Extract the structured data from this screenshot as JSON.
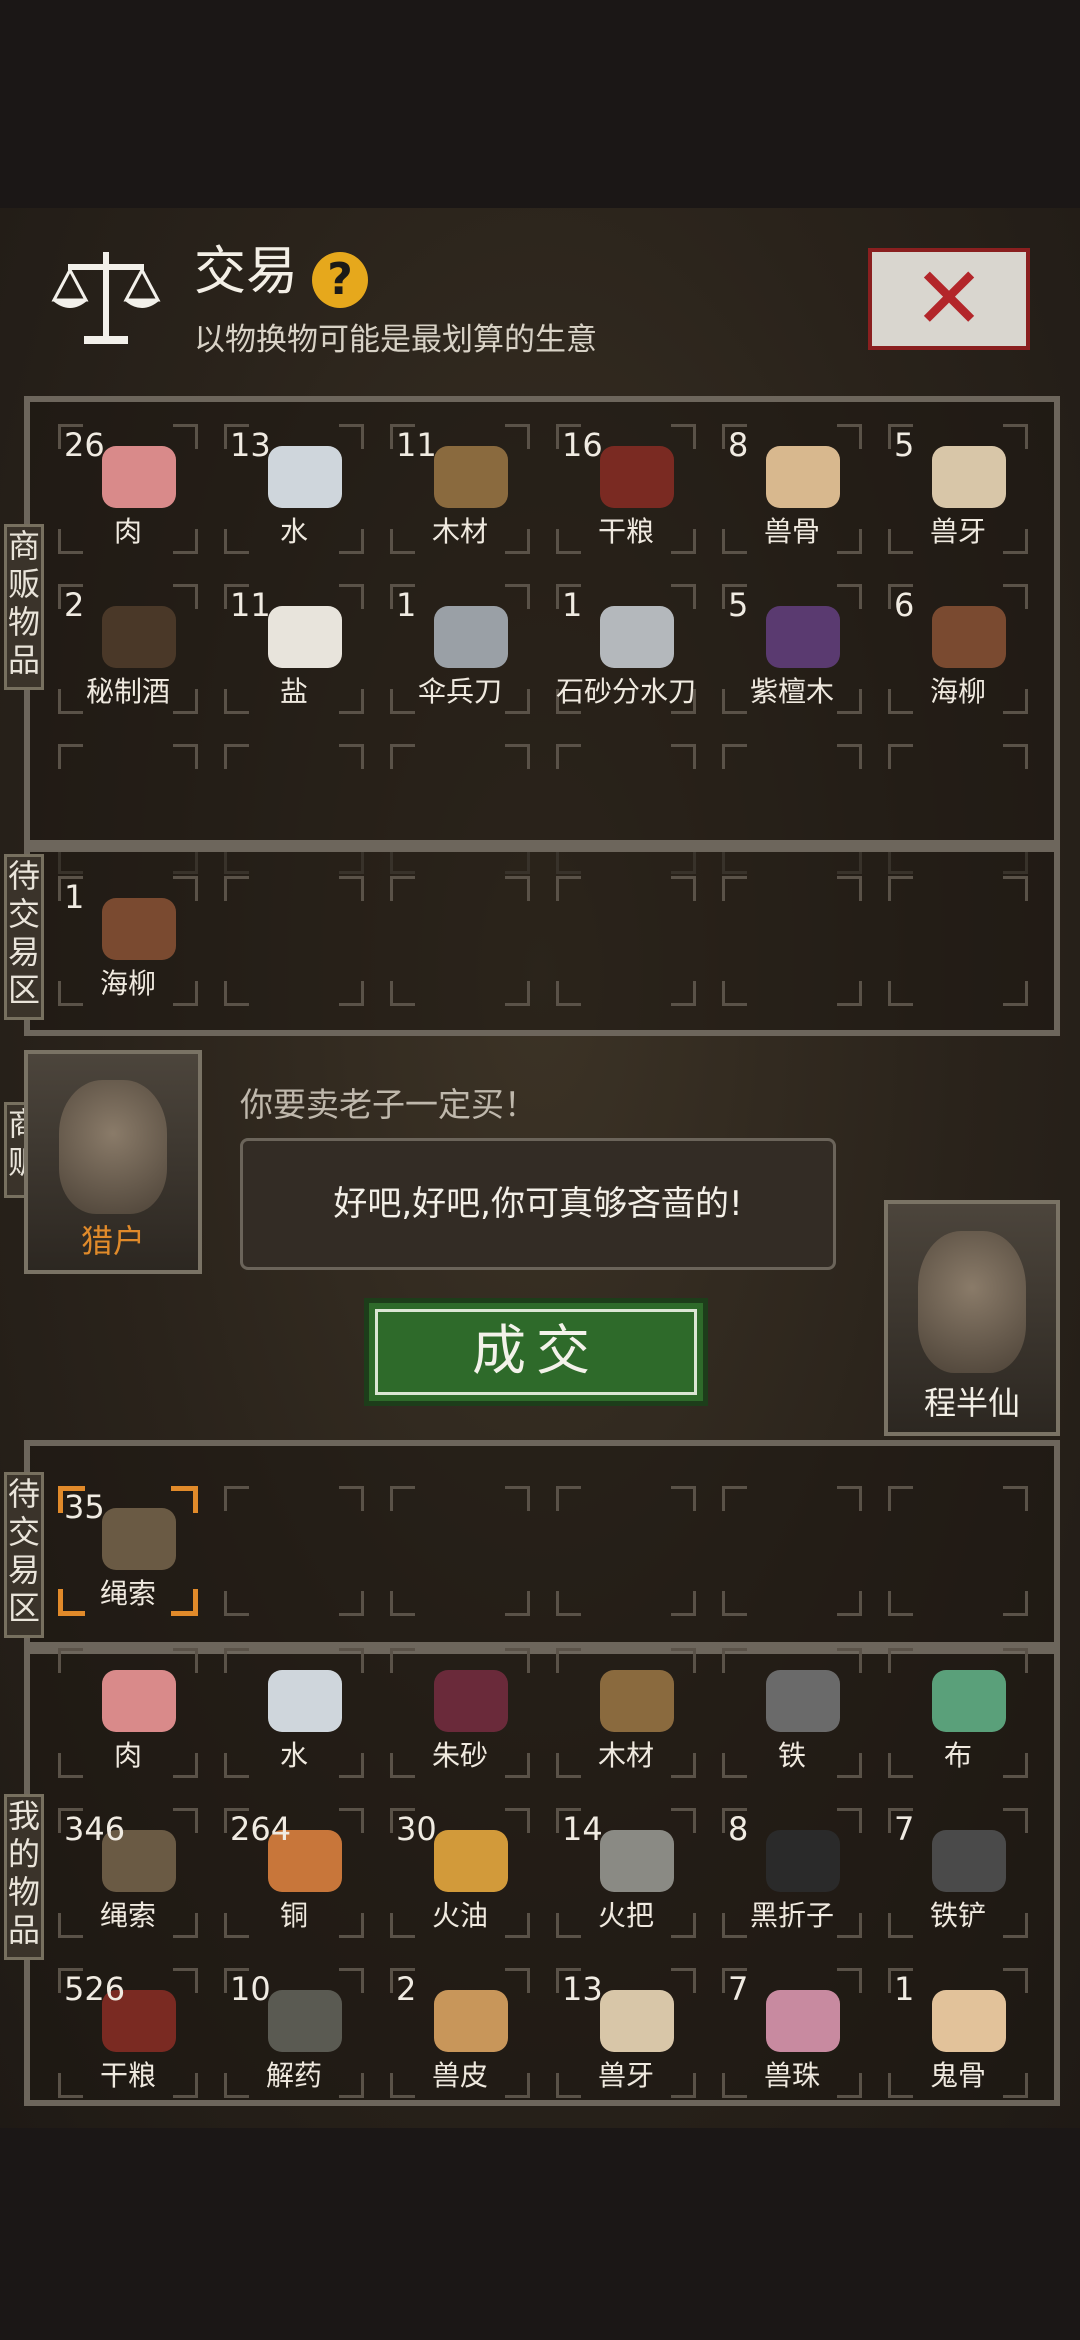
{
  "header": {
    "title": "交易",
    "help_label": "?",
    "subtitle": "以物换物可能是最划算的生意",
    "close_label": "✕"
  },
  "sections": {
    "merchant_goods": "商贩物品",
    "trade_area_top": "待交易区",
    "merchant": "商贩",
    "trade_area_bottom": "待交易区",
    "my_goods": "我的物品"
  },
  "merchant_goods": [
    {
      "count": "26",
      "name": "肉",
      "icon": "meat-icon",
      "color": "#d98a8a"
    },
    {
      "count": "13",
      "name": "水",
      "icon": "water-drop-icon",
      "color": "#cfd6dc"
    },
    {
      "count": "11",
      "name": "木材",
      "icon": "wood-icon",
      "color": "#8a6a3e"
    },
    {
      "count": "16",
      "name": "干粮",
      "icon": "jerky-icon",
      "color": "#7a2a22"
    },
    {
      "count": "8",
      "name": "兽骨",
      "icon": "bone-icon",
      "color": "#d8b88e"
    },
    {
      "count": "5",
      "name": "兽牙",
      "icon": "fang-icon",
      "color": "#d8c6a8"
    },
    {
      "count": "2",
      "name": "秘制酒",
      "icon": "wine-jar-icon",
      "color": "#4a3828"
    },
    {
      "count": "11",
      "name": "盐",
      "icon": "salt-icon",
      "color": "#e8e4dc"
    },
    {
      "count": "1",
      "name": "伞兵刀",
      "icon": "knife-icon",
      "color": "#9aa0a6"
    },
    {
      "count": "1",
      "name": "石砂分水刀",
      "icon": "blade-icon",
      "color": "#b4b8bc"
    },
    {
      "count": "5",
      "name": "紫檀木",
      "icon": "rosewood-icon",
      "color": "#5a3a70"
    },
    {
      "count": "6",
      "name": "海柳",
      "icon": "driftwood-icon",
      "color": "#7a4a30"
    }
  ],
  "merchant_trade": [
    {
      "count": "1",
      "name": "海柳",
      "icon": "driftwood-icon",
      "color": "#7a4a30"
    }
  ],
  "dialog": {
    "merchant_line": "你要卖老子一定买！",
    "reply": "好吧,好吧,你可真够吝啬的!",
    "deal_button": "成交"
  },
  "merchant": {
    "name": "猎户",
    "name_color": "#e08a2a"
  },
  "player": {
    "name": "程半仙",
    "stars": "★★"
  },
  "my_trade": [
    {
      "count": "35",
      "name": "绳索",
      "icon": "rope-icon",
      "color": "#6a5a44"
    }
  ],
  "my_goods": [
    {
      "count": "",
      "name": "肉",
      "icon": "meat-icon",
      "color": "#d98a8a"
    },
    {
      "count": "",
      "name": "水",
      "icon": "water-drop-icon",
      "color": "#cfd6dc"
    },
    {
      "count": "",
      "name": "朱砂",
      "icon": "cinnabar-icon",
      "color": "#6a2a3a"
    },
    {
      "count": "",
      "name": "木材",
      "icon": "wood-icon",
      "color": "#8a6a3e"
    },
    {
      "count": "",
      "name": "铁",
      "icon": "iron-ore-icon",
      "color": "#6a6a6a"
    },
    {
      "count": "",
      "name": "布",
      "icon": "cloth-icon",
      "color": "#5aa07a"
    },
    {
      "count": "346",
      "name": "绳索",
      "icon": "rope-icon",
      "color": "#6a5a44"
    },
    {
      "count": "264",
      "name": "铜",
      "icon": "copper-ore-icon",
      "color": "#c8763a"
    },
    {
      "count": "30",
      "name": "火油",
      "icon": "oil-bottle-icon",
      "color": "#d29a3a"
    },
    {
      "count": "14",
      "name": "火把",
      "icon": "torch-icon",
      "color": "#8a8a84"
    },
    {
      "count": "8",
      "name": "黑折子",
      "icon": "fire-stick-icon",
      "color": "#2a2a2a"
    },
    {
      "count": "7",
      "name": "铁铲",
      "icon": "shovel-icon",
      "color": "#4a4a4a"
    },
    {
      "count": "526",
      "name": "干粮",
      "icon": "jerky-icon",
      "color": "#7a2a22"
    },
    {
      "count": "10",
      "name": "解药",
      "icon": "antidote-flask-icon",
      "color": "#5a5a52"
    },
    {
      "count": "2",
      "name": "兽皮",
      "icon": "pelt-icon",
      "color": "#c8965a"
    },
    {
      "count": "13",
      "name": "兽牙",
      "icon": "fang-icon",
      "color": "#d8c6a8"
    },
    {
      "count": "7",
      "name": "兽珠",
      "icon": "pearl-icon",
      "color": "#c88aa0"
    },
    {
      "count": "1",
      "name": "鬼骨",
      "icon": "bone-icon",
      "color": "#e2c29a"
    }
  ]
}
